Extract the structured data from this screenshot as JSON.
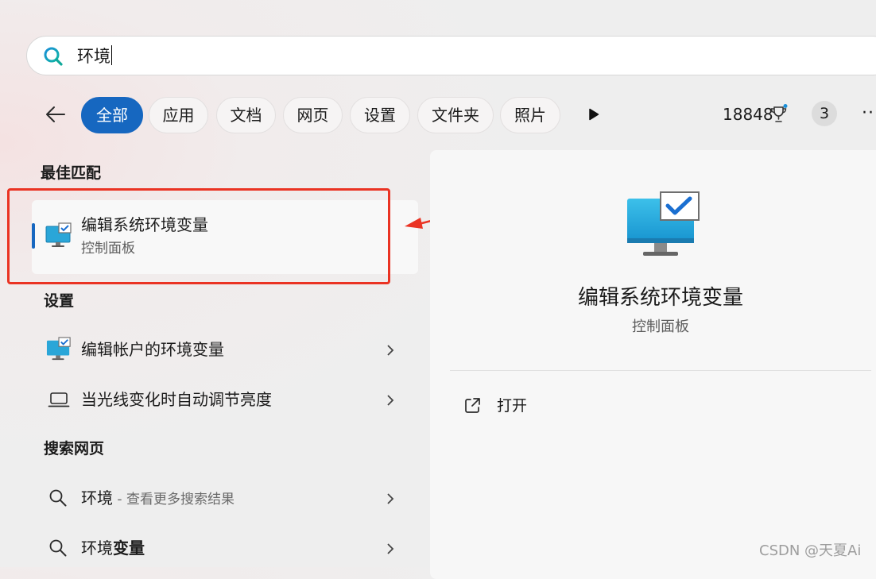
{
  "search": {
    "query": "环境"
  },
  "filters": {
    "chips": [
      {
        "label": "全部",
        "active": true
      },
      {
        "label": "应用"
      },
      {
        "label": "文档"
      },
      {
        "label": "网页"
      },
      {
        "label": "设置"
      },
      {
        "label": "文件夹"
      },
      {
        "label": "照片"
      }
    ],
    "points": "18848",
    "badge_count": "3",
    "more": "···"
  },
  "best_match": {
    "section_title": "最佳匹配",
    "title": "编辑系统环境变量",
    "subtitle": "控制面板"
  },
  "settings": {
    "section_title": "设置",
    "items": [
      {
        "label": "编辑帐户的环境变量",
        "icon": "monitor-check-icon"
      },
      {
        "label": "当光线变化时自动调节亮度",
        "icon": "laptop-icon"
      }
    ]
  },
  "web": {
    "section_title": "搜索网页",
    "items": [
      {
        "label": "环境",
        "suffix": " - 查看更多搜索结果"
      },
      {
        "label_prefix": "环境",
        "label_bold": "变量"
      }
    ]
  },
  "preview": {
    "title": "编辑系统环境变量",
    "subtitle": "控制面板",
    "open_label": "打开"
  },
  "watermark": "CSDN @天夏Ai",
  "colors": {
    "accent": "#1667c0",
    "highlight": "#ea3323"
  }
}
